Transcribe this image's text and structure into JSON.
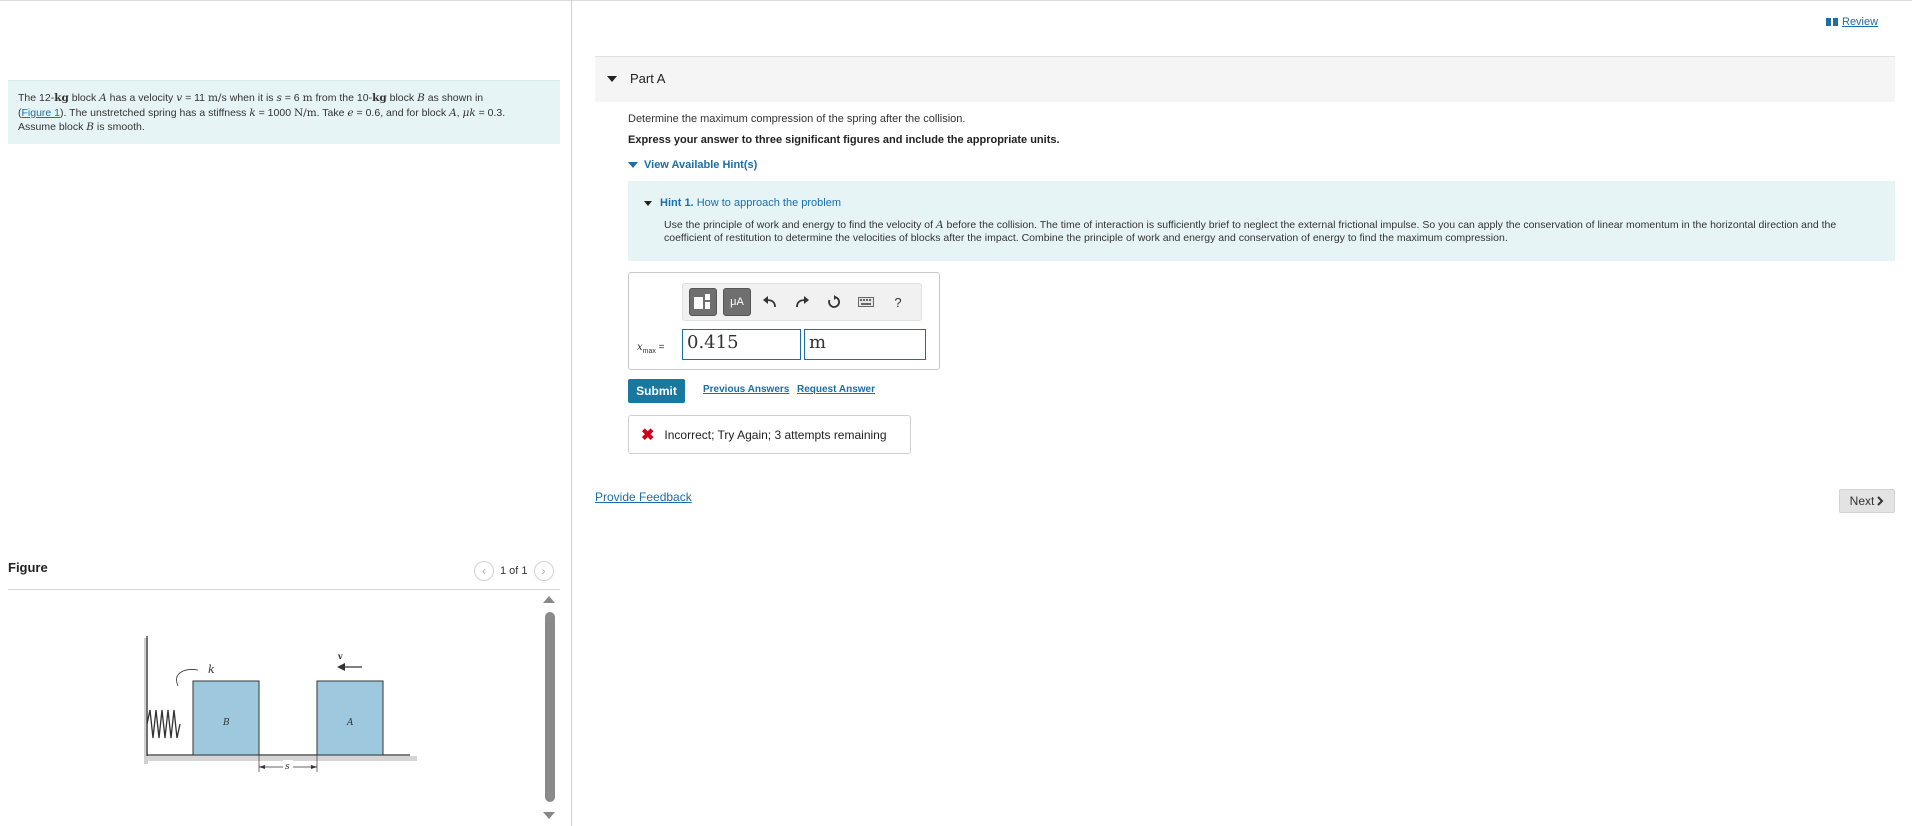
{
  "problem": {
    "t1": "The 12-",
    "kg": "kg",
    "t2": " block ",
    "A": "A",
    "t3": " has a velocity ",
    "v": "v",
    "t4": " = 11 ",
    "ms": "m/s",
    "t5": " when it is ",
    "s": "s",
    "t6": " = 6 ",
    "m": "m",
    "t7": " from the 10-",
    "kg2": "kg",
    "t8": " block ",
    "B": "B",
    "t9": " as shown in ",
    "paren_open": "(",
    "figure_link": "Figure 1",
    "t10": "). The unstretched spring has a stiffness ",
    "k": "k",
    "t11": " = 1000 ",
    "Nm": "N/m",
    "t12": ". Take ",
    "e": "e",
    "t13": " = 0.6, and for block ",
    "A2": "A",
    "t14": ", ",
    "muk": "μk",
    "t15": " = 0.3.",
    "t16": "Assume block ",
    "B2": "B",
    "t17": " is smooth."
  },
  "figure": {
    "title": "Figure",
    "pager": "1 of 1",
    "labels": {
      "k": "k",
      "B": "B",
      "A": "A",
      "v": "v",
      "s": "s"
    }
  },
  "header": {
    "review": "Review"
  },
  "part": {
    "title": "Part A"
  },
  "question": "Determine the maximum compression of the spring after the collision.",
  "instruction": "Express your answer to three significant figures and include the appropriate units.",
  "hints": {
    "toggle": "View Available Hint(s)",
    "hint1_num": "Hint 1.",
    "hint1_title": "How to approach the problem",
    "b1": "Use the principle of work and energy to find the velocity of ",
    "bA": "A",
    "b2": " before the collision. The time of interaction is sufficiently brief to neglect the external frictional impulse. So you can apply the conservation of linear momentum in the horizontal direction and the coefficient of restitution to determine the velocities of blocks after the impact. Combine the principle of work and energy and conservation of energy to find the maximum compression."
  },
  "answer": {
    "var_x": "x",
    "var_sub": "max",
    "equals": "=",
    "value": "0.415",
    "unit": "m",
    "toolbar": {
      "mu": "μA",
      "help": "?"
    }
  },
  "actions": {
    "submit": "Submit",
    "previous": "Previous Answers",
    "request": "Request Answer"
  },
  "feedback": {
    "icon": "✖",
    "message": "Incorrect; Try Again; 3 attempts remaining"
  },
  "footer": {
    "provide_feedback": "Provide Feedback",
    "next": "Next"
  }
}
